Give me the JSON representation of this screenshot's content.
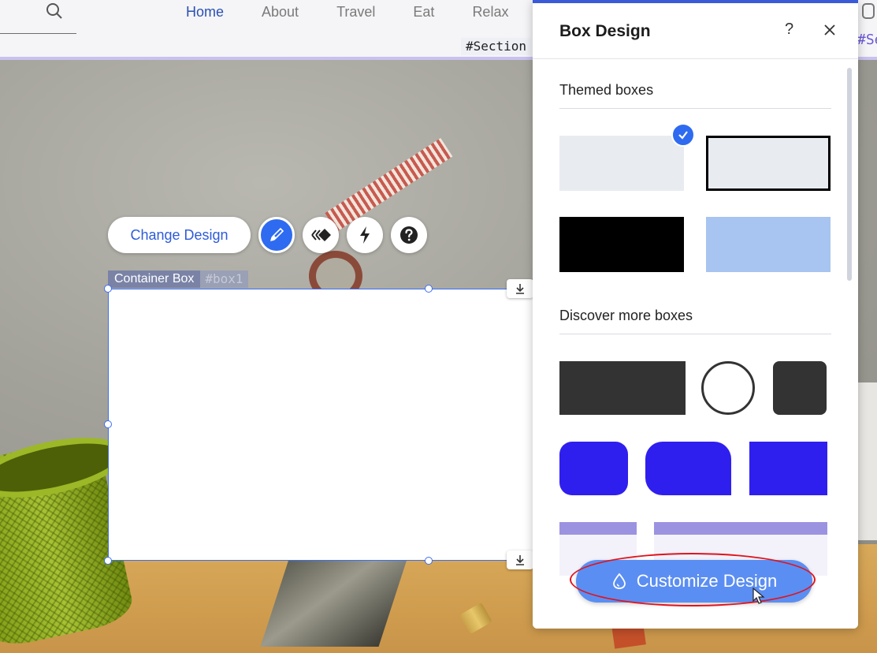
{
  "nav": {
    "items": [
      "Home",
      "About",
      "Travel",
      "Eat",
      "Relax"
    ],
    "active": "Home"
  },
  "header": {
    "section_tag": "#Section",
    "section_tag_right": "#Section"
  },
  "toolbar": {
    "change_design_label": "Change Design",
    "icons": [
      "paintbrush-icon",
      "animation-icon",
      "lightning-icon",
      "question-icon"
    ]
  },
  "selection": {
    "element_label": "Container Box",
    "element_id": "#box1"
  },
  "panel": {
    "title": "Box Design",
    "help_label": "?",
    "themed_title": "Themed boxes",
    "discover_title": "Discover more boxes",
    "customize_label": "Customize Design",
    "themed_swatches": [
      {
        "fill": "#e8ecf1",
        "border": "none",
        "selected": true
      },
      {
        "fill": "#e8ecf1",
        "border": "#000000",
        "selected": false
      },
      {
        "fill": "#000000",
        "border": "none",
        "selected": false
      },
      {
        "fill": "#a8c4f0",
        "border": "none",
        "selected": false
      }
    ],
    "discover_swatches": [
      "dark-rectangle",
      "circle-outline",
      "dark-rounded-square",
      "blue-rounded",
      "blue-tab",
      "blue-square",
      "lavender-header-left",
      "lavender-header-right"
    ]
  },
  "colors": {
    "accent": "#2e6bf0",
    "panel_border": "#3a5ad7",
    "discover_blue": "#2f1fee",
    "highlight": "#e0141c"
  }
}
